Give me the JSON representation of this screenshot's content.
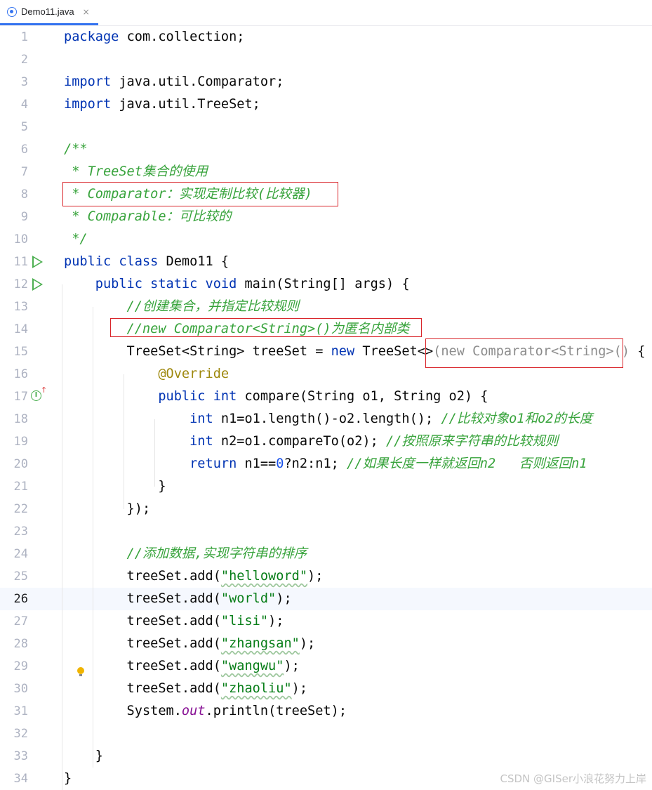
{
  "tab": {
    "label": "Demo11.java",
    "close": "×"
  },
  "editor": {
    "lines": [
      {
        "n": "1"
      },
      {
        "n": "2"
      },
      {
        "n": "3"
      },
      {
        "n": "4"
      },
      {
        "n": "5"
      },
      {
        "n": "6"
      },
      {
        "n": "7"
      },
      {
        "n": "8"
      },
      {
        "n": "9"
      },
      {
        "n": "10"
      },
      {
        "n": "11"
      },
      {
        "n": "12"
      },
      {
        "n": "13"
      },
      {
        "n": "14"
      },
      {
        "n": "15"
      },
      {
        "n": "16"
      },
      {
        "n": "17"
      },
      {
        "n": "18"
      },
      {
        "n": "19"
      },
      {
        "n": "20"
      },
      {
        "n": "21"
      },
      {
        "n": "22"
      },
      {
        "n": "23"
      },
      {
        "n": "24"
      },
      {
        "n": "25"
      },
      {
        "n": "26"
      },
      {
        "n": "27"
      },
      {
        "n": "28"
      },
      {
        "n": "29"
      },
      {
        "n": "30"
      },
      {
        "n": "31"
      },
      {
        "n": "32"
      },
      {
        "n": "33"
      },
      {
        "n": "34"
      }
    ],
    "current_line": "26",
    "tokens": {
      "l1a": "package",
      "l1b": " com.collection;",
      "l3a": "import",
      "l3b": " java.util.Comparator;",
      "l4a": "import",
      "l4b": " java.util.TreeSet;",
      "l6": "/**",
      "l7": " * TreeSet集合的使用",
      "l8": " * Comparator：实现定制比较(比较器)",
      "l9": " * Comparable：可比较的",
      "l10": " */",
      "l11a": "public class",
      "l11b": " Demo11 {",
      "l12a": "    public static void",
      "l12b": " main(String[] args) {",
      "l13": "        //创建集合，并指定比较规则",
      "l14": "        //new Comparator<String>()为匿名内部类",
      "l15a": "        TreeSet<String> treeSet = ",
      "l15b": "new",
      "l15c": " TreeSet<>",
      "l15d": "(new Comparator<String>()",
      "l15e": " {",
      "l16": "            @Override",
      "l17a": "            public int",
      "l17b": " compare(String o1, String o2) {",
      "l18a": "                int",
      "l18b": " n1=o1.length()-o2.length(); ",
      "l18c": "//比较对象o1和o2的长度",
      "l19a": "                int",
      "l19b": " n2=o1.compareTo(o2); ",
      "l19c": "//按照原来字符串的比较规则",
      "l20a": "                return",
      "l20b": " n1==",
      "l20c": "0",
      "l20d": "?n2:n1; ",
      "l20e": "//如果长度一样就返回n2   否则返回n1",
      "l21": "            }",
      "l22": "        });",
      "l24": "        //添加数据,实现字符串的排序",
      "l25a": "        treeSet.add(",
      "l25b": "\"helloword\"",
      "l25c": ");",
      "l26a": "        treeSet.add(",
      "l26b": "\"world\"",
      "l26c": ");",
      "l27a": "        treeSet.add(",
      "l27b": "\"lisi\"",
      "l27c": ");",
      "l28a": "        treeSet.add(",
      "l28b": "\"zhangsan\"",
      "l28c": ");",
      "l29a": "        treeSet.add(",
      "l29b": "\"wangwu\"",
      "l29c": ");",
      "l30a": "        treeSet.add(",
      "l30b": "\"zhaoliu\"",
      "l30c": ");",
      "l31a": "        System.",
      "l31b": "out",
      "l31c": ".println(treeSet);",
      "l33": "    }",
      "l34": "}"
    }
  },
  "gutter_icons": {
    "run_main_class": "run-icon",
    "run_main_method": "run-icon",
    "implements": "implements-icon",
    "intention": "lightbulb-icon"
  },
  "colors": {
    "keyword": "#0033b3",
    "comment": "#37a33b",
    "string": "#067d17",
    "annotation": "#9e880d",
    "highlight_box": "#d9252a"
  },
  "watermark": "CSDN @GISer小浪花努力上岸"
}
